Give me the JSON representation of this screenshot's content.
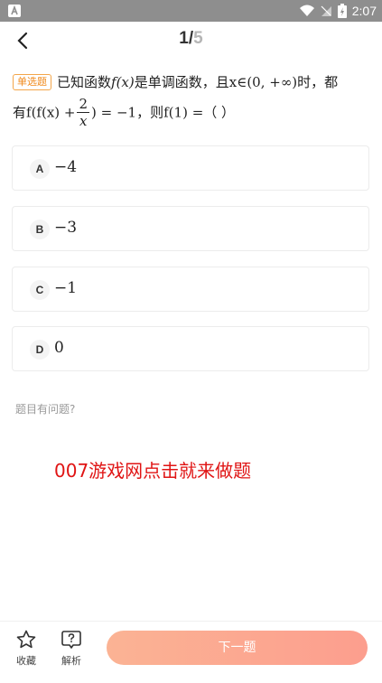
{
  "status_bar": {
    "time": "2:07",
    "icons": [
      "android-icon",
      "wifi-icon",
      "no-sim-icon",
      "battery-charging-icon"
    ]
  },
  "nav": {
    "back_icon": "chevron-left-icon",
    "progress_current": "1",
    "progress_separator": "/",
    "progress_total": "5"
  },
  "question": {
    "type_tag": "单选题",
    "seg1": "已知函数",
    "fx": "f(x)",
    "seg2": "是单调函数，且",
    "cond": "x∈(0, +∞)",
    "seg3": "时，都",
    "line2_pre": "有",
    "expr_left": "f(f(x) +",
    "frac_num": "2",
    "frac_den": "x",
    "expr_right": ") = −1",
    "seg4": "，则",
    "ask": "f(1) =",
    "blank": "（ ）"
  },
  "options": [
    {
      "letter": "A",
      "text": "−4"
    },
    {
      "letter": "B",
      "text": "−3"
    },
    {
      "letter": "C",
      "text": "−1"
    },
    {
      "letter": "D",
      "text": "0"
    }
  ],
  "report_link": "题目有问题?",
  "promo_text": "007游戏网点击就来做题",
  "bottom_bar": {
    "favorite_label": "收藏",
    "favorite_icon": "star-outline-icon",
    "analysis_label": "解析",
    "analysis_icon": "question-box-icon",
    "next_label": "下一题"
  },
  "colors": {
    "tag": "#f08a1c",
    "promo": "#e01414",
    "next_button_start": "#fbb394",
    "next_button_end": "#fc9e8e",
    "status_bar": "#8e8e8e"
  }
}
